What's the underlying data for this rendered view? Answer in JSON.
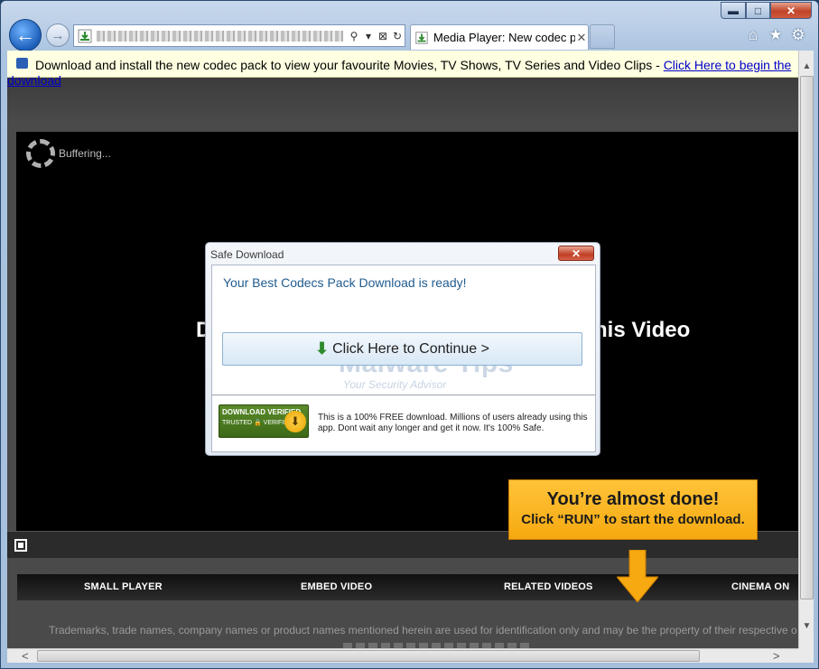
{
  "browser": {
    "caption": {
      "minimize": "▬",
      "maximize": "□",
      "close": "✕"
    },
    "back_icon": "←",
    "forward_icon": "→",
    "address_buttons": [
      "⚲",
      "▾",
      "⊠",
      "↻"
    ],
    "tab_title": "Media Player: New codec p...",
    "tab_close": "✕",
    "toolbar_icons": {
      "home": "⌂",
      "favorites": "★",
      "tools": "⚙"
    }
  },
  "notification": {
    "text": "Download and install the new codec pack to view your favourite Movies, TV Shows, TV Series and Video Clips - ",
    "link": "Click Here to begin the",
    "link_overflow": "download"
  },
  "player": {
    "buffering": "Buffering...",
    "headline_left": "D",
    "headline_right": "his Video"
  },
  "dialog": {
    "title": "Safe Download",
    "close": "✕",
    "ready_text": "Your Best Codecs Pack Download is ready!",
    "continue_label": "Click Here to Continue >",
    "continue_icon": "⬇",
    "watermark": "Malware Tips",
    "watermark_tagline": "Your Security Advisor",
    "badge_top": "DOWNLOAD VERIFIED",
    "badge_bottom": "TRUSTED 🔒 VERIFIED",
    "badge_icon": "⬇",
    "note": "This is a 100% FREE download. Millions of users already using this app. Dont wait any longer and get it now. It's 100% Safe."
  },
  "callout": {
    "title": "You’re almost done!",
    "subtitle": "Click “RUN” to start the download.",
    "color": "#f6a910"
  },
  "nav": [
    "SMALL PLAYER",
    "EMBED VIDEO",
    "RELATED VIDEOS",
    "CINEMA ON"
  ],
  "footer": {
    "text": "Trademarks, trade names, company names or product names mentioned herein are used for identification only and may be the property of their respective o"
  },
  "scroll": {
    "up": "▲",
    "down": "▼",
    "left": "<",
    "right": ">"
  }
}
